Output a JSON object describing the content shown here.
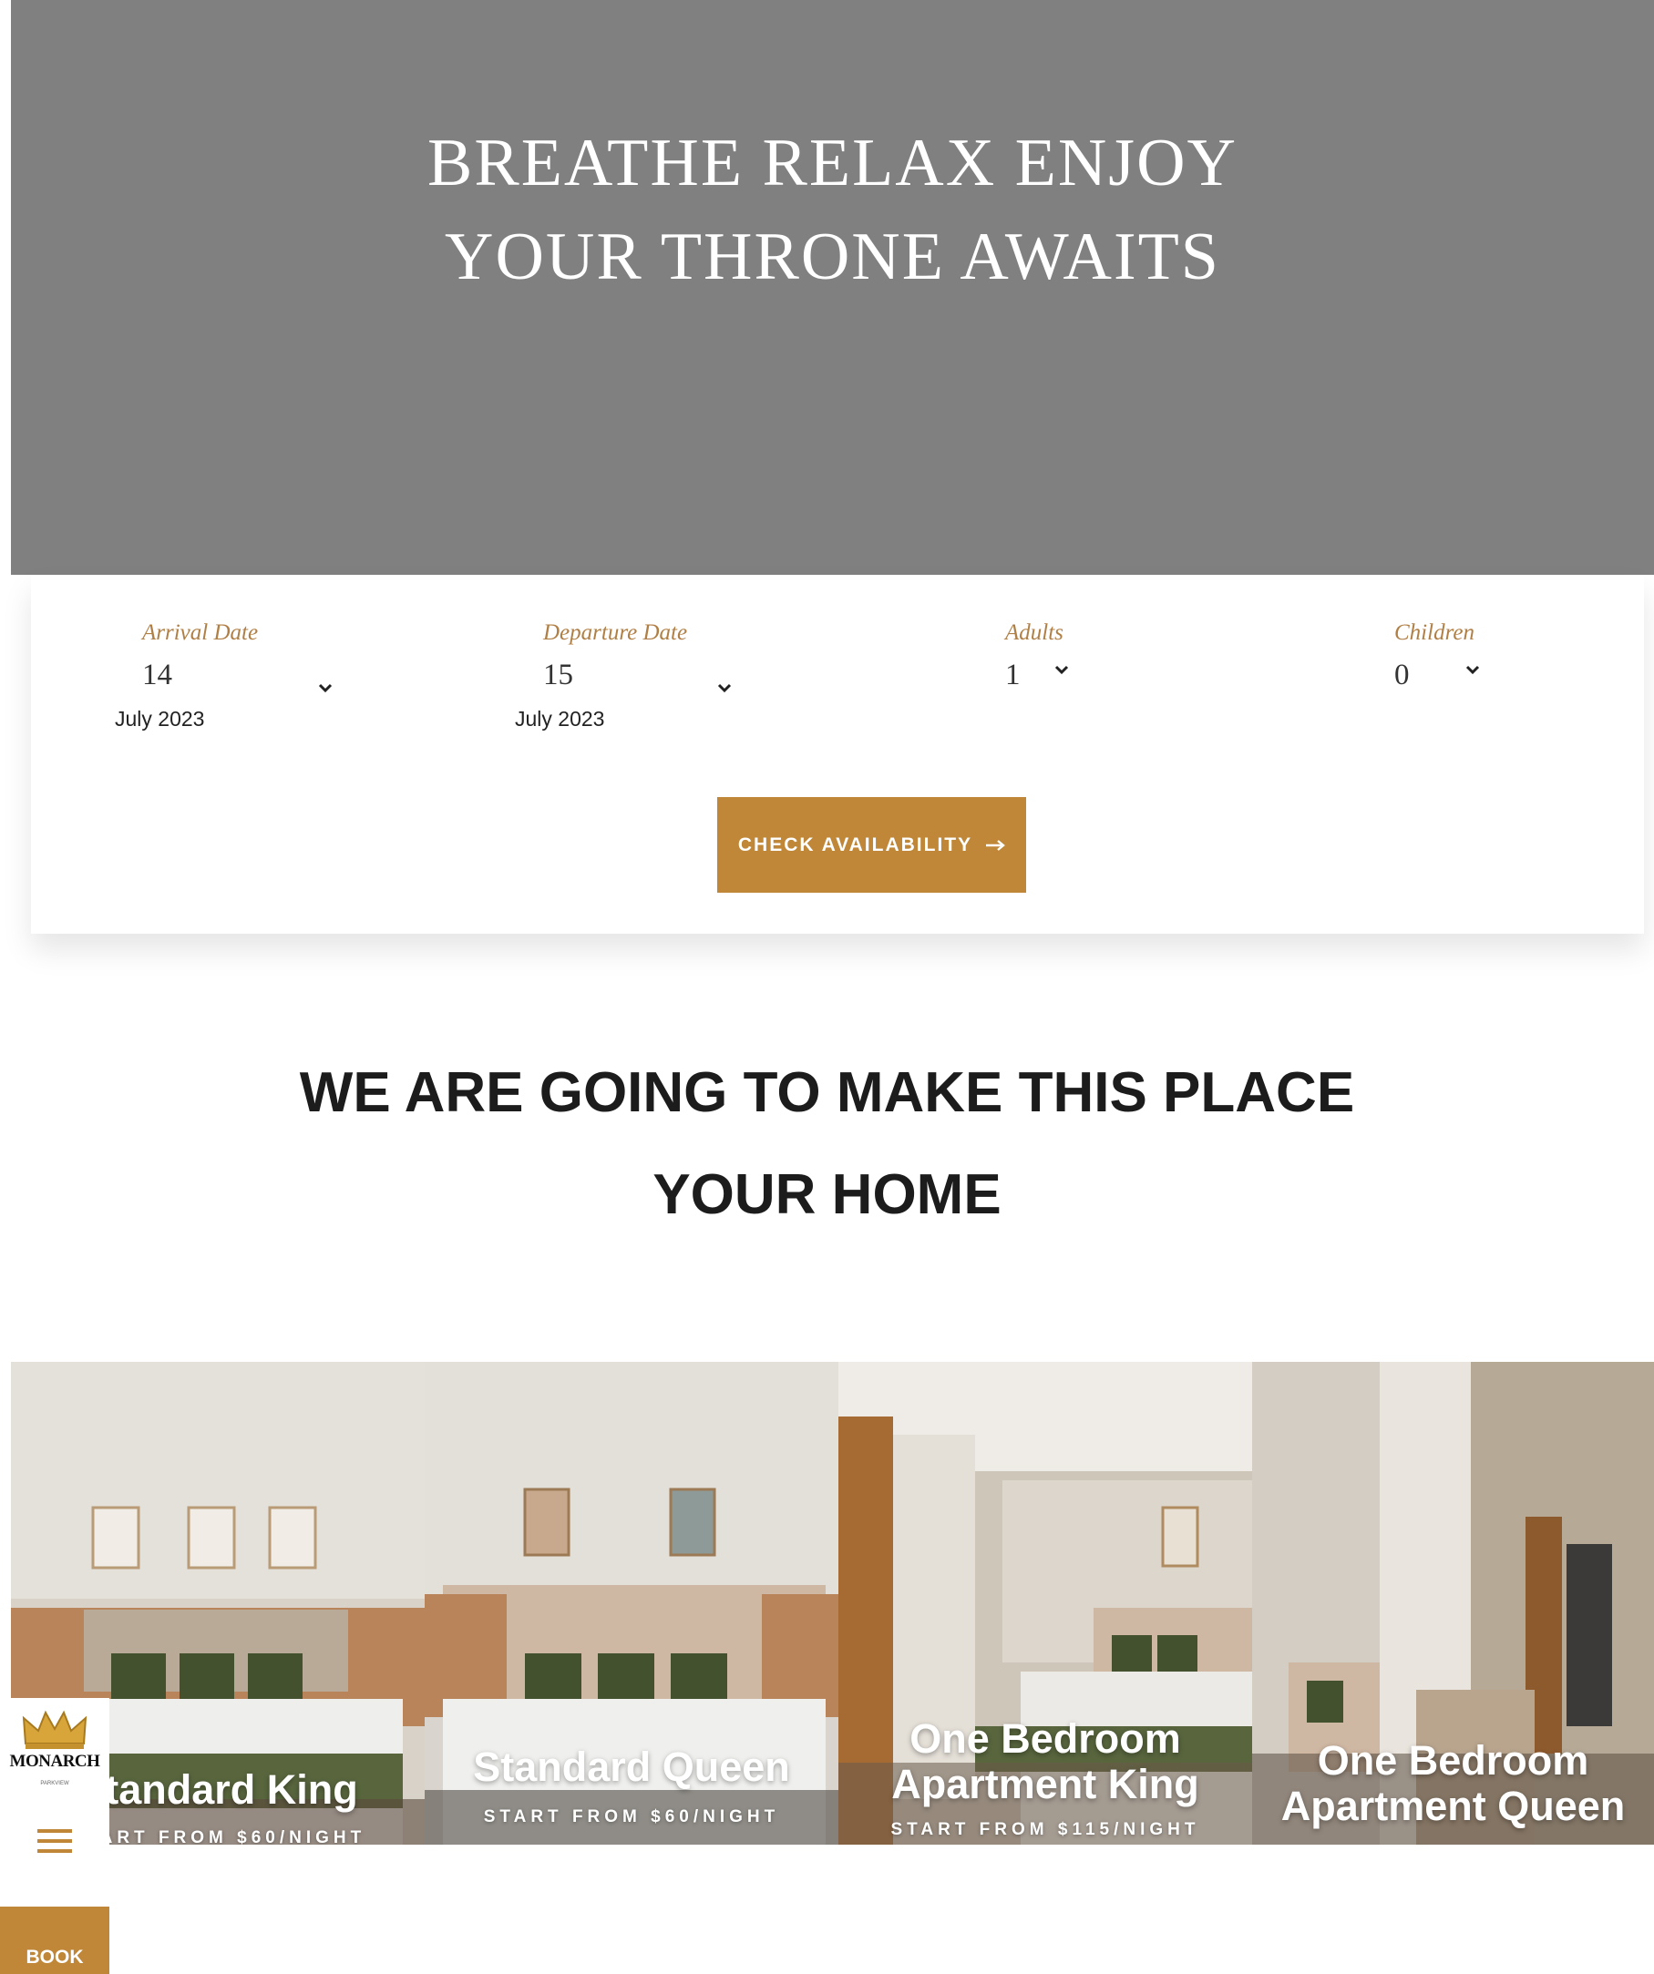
{
  "hero": {
    "line1": "BREATHE RELAX ENJOY",
    "line2": "YOUR THRONE AWAITS"
  },
  "booking": {
    "arrival": {
      "label": "Arrival Date",
      "day": "14",
      "month": "July 2023"
    },
    "departure": {
      "label": "Departure Date",
      "day": "15",
      "month": "July 2023"
    },
    "adults": {
      "label": "Adults",
      "value": "1"
    },
    "children": {
      "label": "Children",
      "value": "0"
    },
    "check_label": "CHECK AVAILABILITY",
    "check_icon": "arrow-right-icon"
  },
  "tagline": {
    "line1": "WE ARE GOING TO MAKE THIS PLACE",
    "line2": "YOUR HOME"
  },
  "rooms": [
    {
      "name": "Standard King",
      "price": "START FROM $60/NIGHT"
    },
    {
      "name": "Standard Queen",
      "price": "START FROM $60/NIGHT"
    },
    {
      "name": "One Bedroom Apartment King",
      "price": "START FROM $115/NIGHT"
    },
    {
      "name": "One Bedroom Apartment Queen",
      "price": ""
    }
  ],
  "sidebar": {
    "logo_text": "MONARCH",
    "logo_sub": "PARKVIEW",
    "menu_icon": "hamburger-icon",
    "book_label": "BOOK"
  },
  "colors": {
    "hero_bg": "#808080",
    "accent": "#bf8737",
    "label": "#b07f45",
    "heading": "#1c1c1c"
  }
}
